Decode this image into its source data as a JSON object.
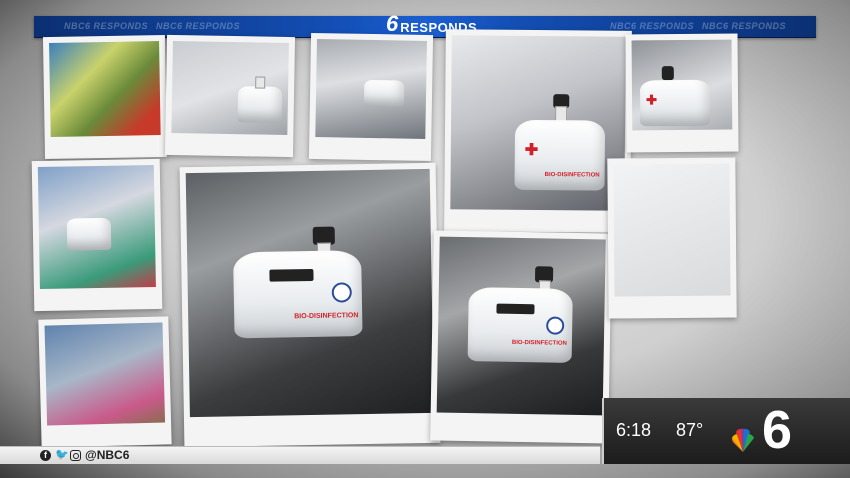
{
  "banner": {
    "repeat_text": "NBC6 RESPONDS",
    "logo_number": "6",
    "logo_text": "RESPONDS"
  },
  "robot_labels": {
    "large": "BIO-DISINFECTION",
    "medium": "BIO-DISINFECTION",
    "small": "BIO-DISINFECTION"
  },
  "social": {
    "handle": "@NBC6",
    "icons": [
      "facebook-icon",
      "twitter-icon",
      "instagram-icon"
    ]
  },
  "bug": {
    "time": "6:18",
    "temperature": "87°",
    "channel": "6"
  },
  "colors": {
    "banner_blue": "#1450b8",
    "robot_red": "#d2202a",
    "bug_dark": "#1c1c1c"
  }
}
